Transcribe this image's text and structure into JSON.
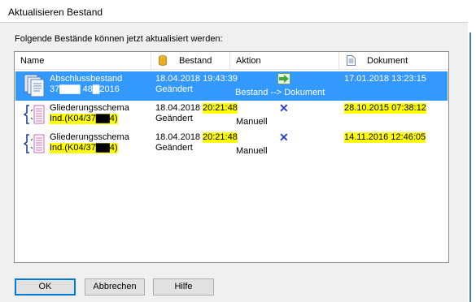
{
  "window": {
    "title": "Aktualisieren Bestand"
  },
  "intro_text": "Folgende Bestände können jetzt aktualisiert werden:",
  "columns": {
    "name": "Name",
    "bestand": "Bestand",
    "aktion": "Aktion",
    "dokument": "Dokument"
  },
  "rows": [
    {
      "name_line1": "Abschlussbestand",
      "name_line2": "37▇▇▇ 48▇2016",
      "bestand_date": "18.04.2018 19:43:39",
      "bestand_status": "Geändert",
      "aktion": "Bestand --> Dokument",
      "dokument": "17.01.2018 13:23:15",
      "selected": true
    },
    {
      "name_line1": "Gliederungsschema",
      "name_line2": "Ind.(K04/37▇▇4)",
      "bestand_date": "18.04.2018",
      "bestand_time": "20:21:48",
      "bestand_status": "Geändert",
      "aktion": "Manuell",
      "dokument": "28.10.2015 07:38:12",
      "selected": false
    },
    {
      "name_line1": "Gliederungsschema",
      "name_line2": "Ind.(K04/37▇▇4)",
      "bestand_date": "18.04.2018",
      "bestand_time": "20:21:48",
      "bestand_status": "Geändert",
      "aktion": "Manuell",
      "dokument": "14.11.2016 12:46:05",
      "selected": false
    }
  ],
  "buttons": {
    "ok": "OK",
    "cancel": "Abbrechen",
    "help": "Hilfe"
  },
  "colors": {
    "selection": "#3399ff",
    "highlight": "#ffff00",
    "x_mark": "#2a3fcf"
  }
}
